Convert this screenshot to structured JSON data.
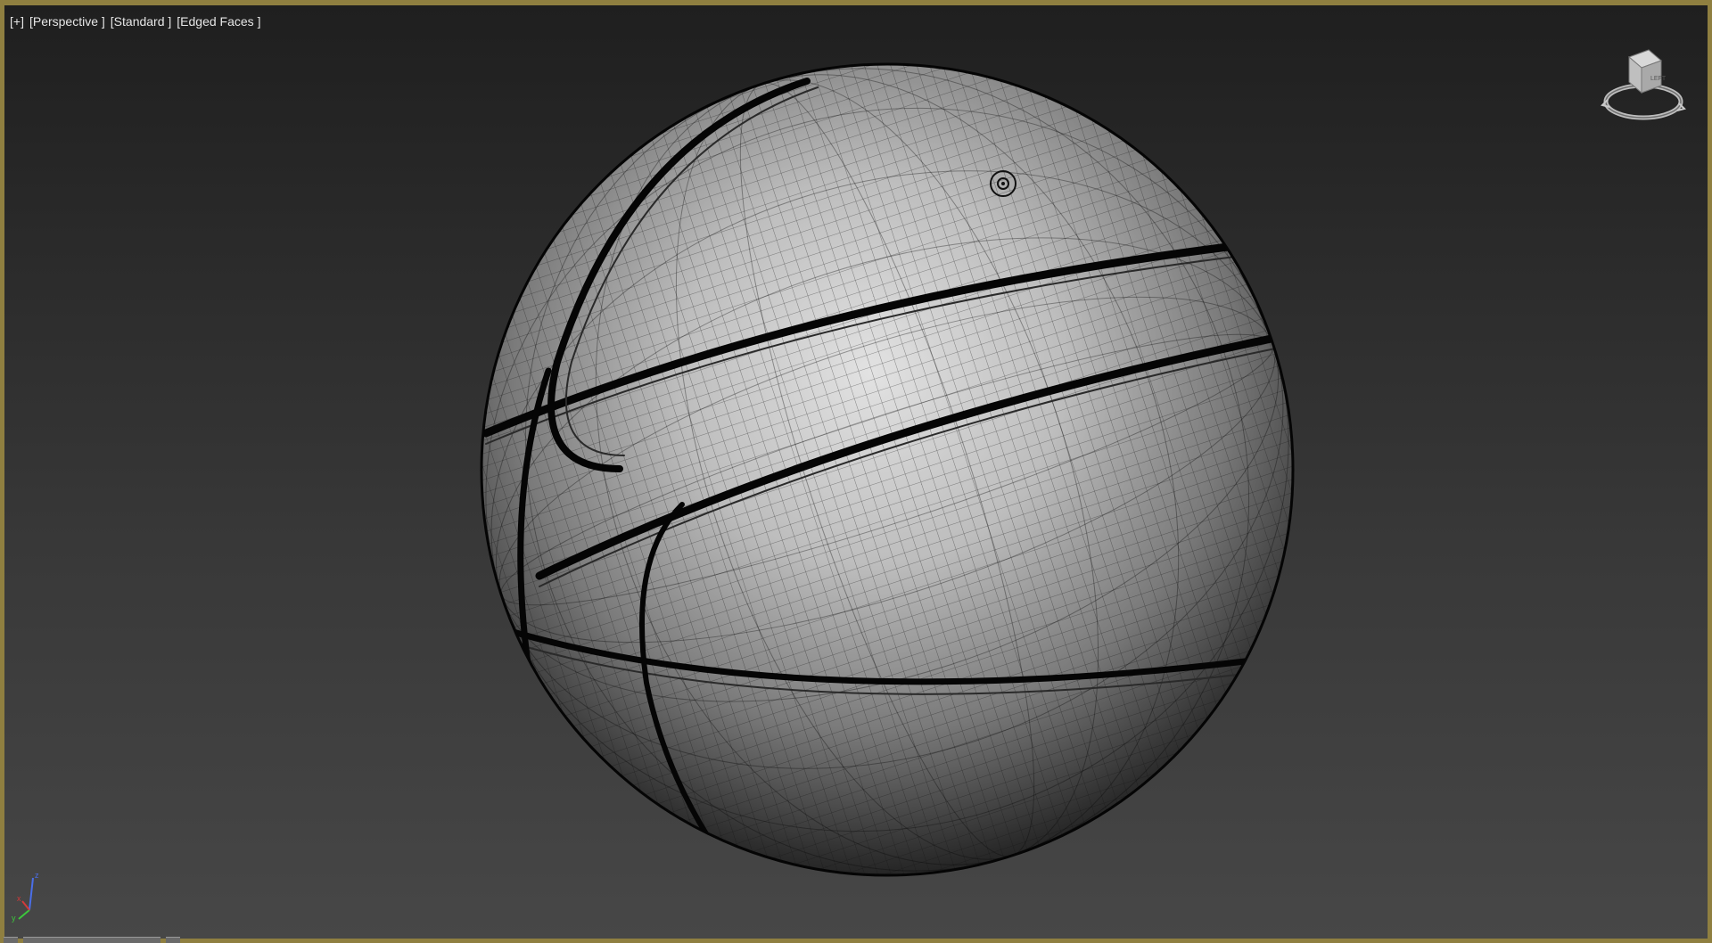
{
  "viewport": {
    "labels": {
      "menu": "[+]",
      "point_of_view": "[Perspective ]",
      "shading": "[Standard ]",
      "display_mode": "[Edged Faces ]"
    },
    "active_border_color": "#8f7f40",
    "object": "basketball-mesh"
  },
  "viewcube": {
    "icon": "viewcube-icon",
    "face_label": "LEFT"
  },
  "axis_tripod": {
    "x": "x",
    "y": "y",
    "z": "z",
    "colors": {
      "x": "#d23a3a",
      "y": "#3cc83c",
      "z": "#4a6ee8"
    }
  }
}
